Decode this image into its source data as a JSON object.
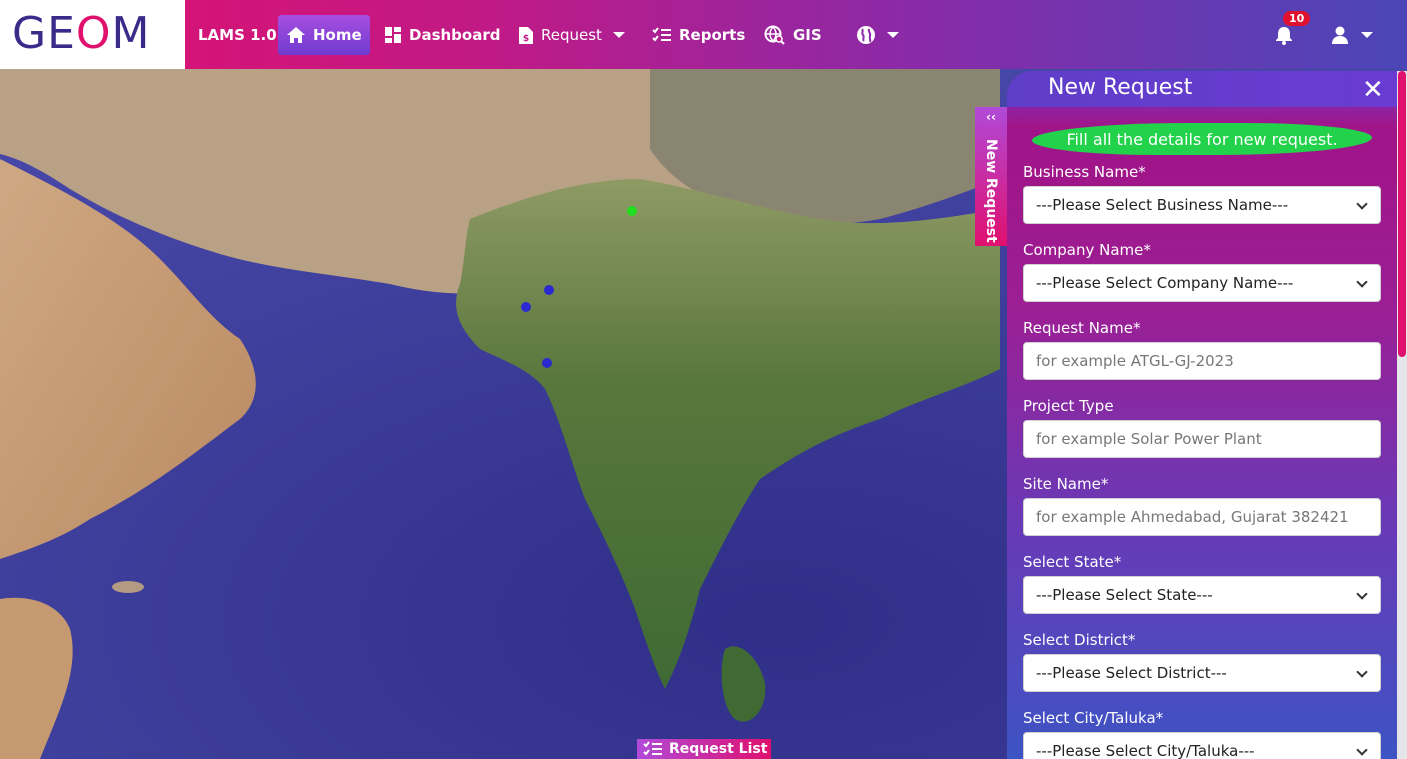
{
  "app": {
    "logo_text_1": "GE",
    "logo_text_2": "O",
    "logo_text_3": "M",
    "brand": "LAMS 1.0"
  },
  "nav": {
    "home": "Home",
    "dashboard": "Dashboard",
    "request": "Request",
    "reports": "Reports",
    "gis": "GIS",
    "notification_count": "10"
  },
  "map": {
    "request_list_label": "Request List",
    "side_tab_label": "New Request",
    "markers": [
      {
        "color": "#1ee01e"
      },
      {
        "color": "#2a2ad0"
      },
      {
        "color": "#2a2ad0"
      },
      {
        "color": "#2a2ad0"
      }
    ]
  },
  "panel": {
    "title": "New Request",
    "hint": "Fill all the details for new request.",
    "business_name": {
      "label": "Business Name*",
      "value": "---Please Select Business Name---"
    },
    "company_name": {
      "label": "Company Name*",
      "value": "---Please Select Company Name---"
    },
    "request_name": {
      "label": "Request Name*",
      "placeholder": "for example ATGL-GJ-2023"
    },
    "project_type": {
      "label": "Project Type",
      "placeholder": "for example Solar Power Plant"
    },
    "site_name": {
      "label": "Site Name*",
      "placeholder": "for example Ahmedabad, Gujarat 382421"
    },
    "state": {
      "label": "Select State*",
      "value": "---Please Select State---"
    },
    "district": {
      "label": "Select District*",
      "value": "---Please Select District---"
    },
    "city": {
      "label": "Select City/Taluka*",
      "value": "---Please Select City/Taluka---"
    }
  },
  "colors": {
    "accent": "#e0106e",
    "purple": "#6a3bd0",
    "hint_green": "#22d24a"
  }
}
